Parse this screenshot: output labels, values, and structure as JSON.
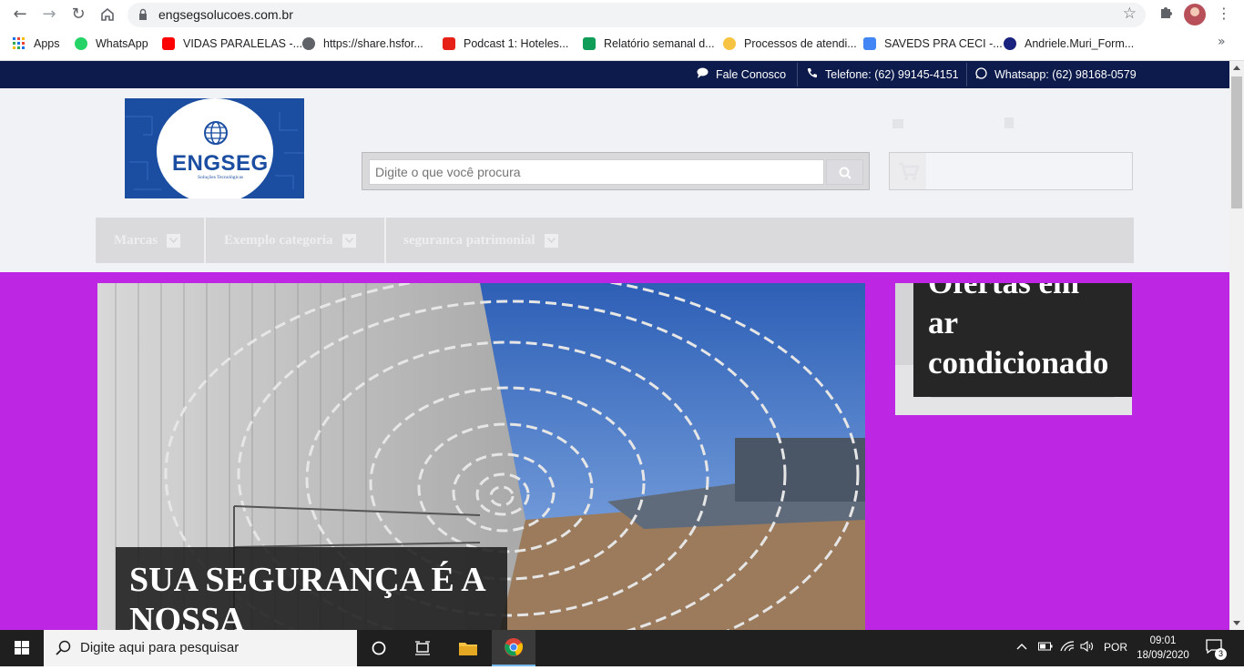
{
  "browser": {
    "url": "engsegsolucoes.com.br",
    "bookmarks": [
      {
        "label": "Apps",
        "icon": "apps-grid-icon"
      },
      {
        "label": "WhatsApp",
        "icon": "whatsapp-icon"
      },
      {
        "label": "VIDAS PARALELAS -...",
        "icon": "youtube-icon"
      },
      {
        "label": "https://share.hsfor...",
        "icon": "globe-icon"
      },
      {
        "label": "Podcast 1: Hoteles...",
        "icon": "podcast-icon"
      },
      {
        "label": "Relatório semanal d...",
        "icon": "sheets-icon"
      },
      {
        "label": "Processos de atendi...",
        "icon": "handshake-icon"
      },
      {
        "label": "SAVEDS PRA CECI -...",
        "icon": "docs-icon"
      },
      {
        "label": "Andriele.Muri_Form...",
        "icon": "world-icon"
      }
    ]
  },
  "site": {
    "topbar": {
      "contact": "Fale Conosco",
      "phone": "Telefone: (62) 99145-4151",
      "whatsapp": "Whatsapp: (62) 98168-0579"
    },
    "logo": {
      "brand": "ENGSEG",
      "tagline": "Soluções Tecnológicas"
    },
    "search": {
      "placeholder": "Digite o que você procura"
    },
    "nav": [
      {
        "label": "Marcas"
      },
      {
        "label": "Exemplo categoria"
      },
      {
        "label": "seguranca patrimonial"
      }
    ],
    "banner": {
      "caption": "SUA SEGURANÇA É A NOSSA"
    },
    "side_banner": {
      "caption_line1": "Ofertas em",
      "caption_line2": "ar",
      "caption_line3": "condicionado"
    },
    "colors": {
      "topbar": "#0c1b4b",
      "hero_background": "#bd27e3",
      "logo_blue": "#1b4ea1"
    }
  },
  "taskbar": {
    "search_placeholder": "Digite aqui para pesquisar",
    "language": "POR",
    "time": "09:01",
    "date": "18/09/2020",
    "notifications": "3"
  }
}
